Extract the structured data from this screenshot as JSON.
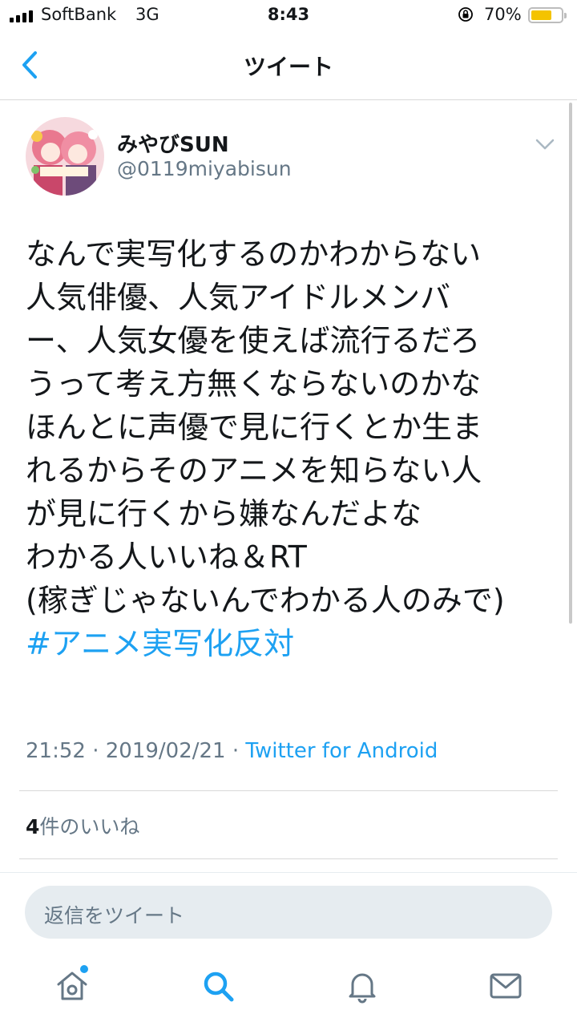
{
  "status_bar": {
    "carrier": "SoftBank",
    "network": "3G",
    "time": "8:43",
    "battery_percent": "70%",
    "battery_level": 0.7,
    "battery_color": "#f4c300"
  },
  "nav": {
    "title": "ツイート",
    "back_icon": "chevron-left-icon"
  },
  "tweet": {
    "author_name": "みやびSUN",
    "author_handle": "@0119miyabisun",
    "lines": [
      "なんで実写化するのかわからない",
      "人気俳優、人気アイドルメンバ",
      "ー、人気女優を使えば流行るだろ",
      "うって考え方無くならないのかな",
      "ほんとに声優で見に行くとか生ま",
      "れるからそのアニメを知らない人",
      "が見に行くから嫌なんだよな",
      "わかる人いいね＆RT",
      "(稼ぎじゃないんでわかる人のみで)"
    ],
    "hashtag": "#アニメ実写化反対",
    "time": "21:52",
    "date": "2019/02/21",
    "separator": "·",
    "source": "Twitter for Android",
    "likes_count": "4",
    "likes_label": "件のいいね"
  },
  "reply": {
    "placeholder": "返信をツイート"
  },
  "tabbar": {
    "items": [
      "home-icon",
      "search-icon",
      "notifications-icon",
      "messages-icon"
    ]
  },
  "colors": {
    "accent": "#1da1f2",
    "muted": "#657786",
    "text": "#14171a"
  }
}
